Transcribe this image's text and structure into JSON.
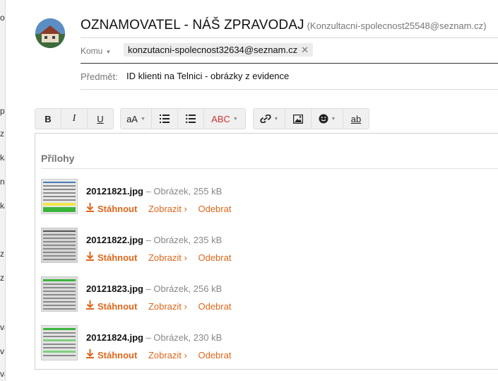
{
  "sidebar_fragments": [
    "or",
    "p",
    "z",
    "ka",
    "na",
    "ka",
    "z",
    "z",
    "va",
    "v",
    "va"
  ],
  "header": {
    "sender_name": "OZNAMOVATEL - NÁŠ ZPRAVODAJ",
    "sender_email": "(Konzultacni-spolecnost25548@seznam.cz)"
  },
  "komu": {
    "label": "Komu",
    "recipient": "konzutacni-spolecnost32634@seznam.cz"
  },
  "subject": {
    "label": "Předmět:",
    "value": "ID klienti na Telnici - obrázky z evidence"
  },
  "toolbar": {
    "bold": "B",
    "italic": "I",
    "underline": "U",
    "font_size": "aA",
    "spellcheck": "ABC",
    "strike": "ab"
  },
  "attachments_title": "Přílohy",
  "attachments": [
    {
      "name": "20121821.jpg",
      "meta": " – Obrázek, 255 kB"
    },
    {
      "name": "20121822.jpg",
      "meta": " – Obrázek, 235 kB"
    },
    {
      "name": "20121823.jpg",
      "meta": " – Obrázek, 256 kB"
    },
    {
      "name": "20121824.jpg",
      "meta": " – Obrázek, 230 kB"
    }
  ],
  "actions": {
    "download": "Stáhnout",
    "show": "Zobrazit ›",
    "remove": "Odebrat"
  },
  "colors": {
    "accent": "#e0661b"
  }
}
